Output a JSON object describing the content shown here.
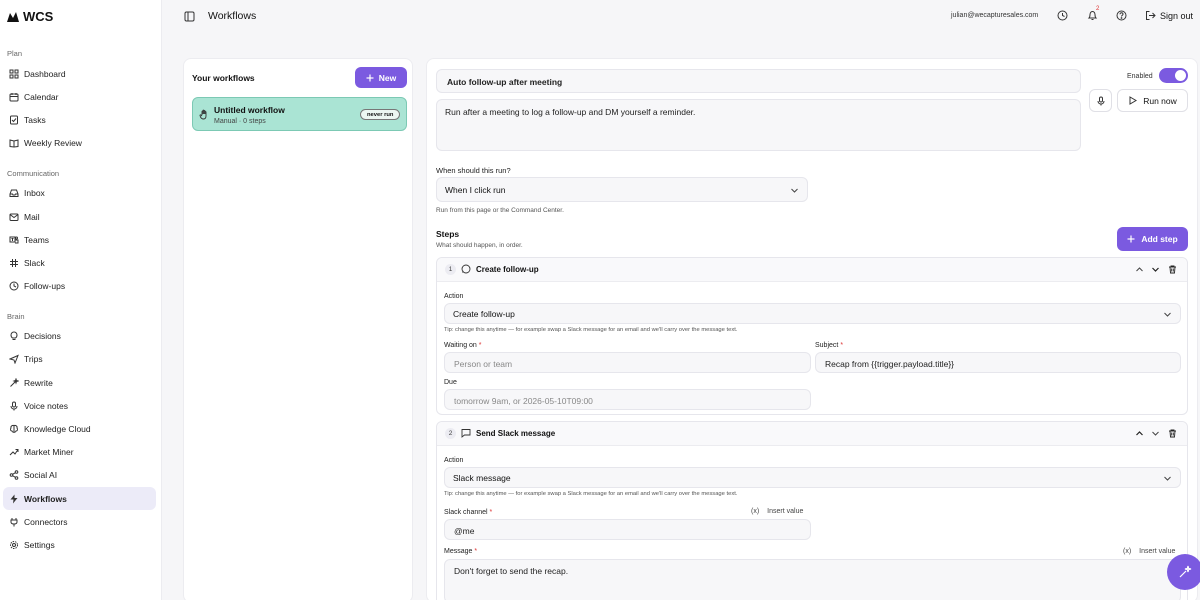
{
  "app": {
    "logo_text": "WCS"
  },
  "sidebar": {
    "sections": [
      {
        "label": "Plan",
        "items": [
          {
            "label": "Dashboard",
            "icon": "grid-icon"
          },
          {
            "label": "Calendar",
            "icon": "calendar-icon"
          },
          {
            "label": "Tasks",
            "icon": "checklist-icon"
          },
          {
            "label": "Weekly Review",
            "icon": "book-icon"
          }
        ]
      },
      {
        "label": "Communication",
        "items": [
          {
            "label": "Inbox",
            "icon": "inbox-icon"
          },
          {
            "label": "Mail",
            "icon": "mail-icon"
          },
          {
            "label": "Teams",
            "icon": "teams-icon"
          },
          {
            "label": "Slack",
            "icon": "slack-icon"
          },
          {
            "label": "Follow-ups",
            "icon": "clock-icon"
          }
        ]
      },
      {
        "label": "Brain",
        "items": [
          {
            "label": "Decisions",
            "icon": "bulb-icon"
          },
          {
            "label": "Trips",
            "icon": "plane-icon"
          },
          {
            "label": "Rewrite",
            "icon": "wand-icon"
          },
          {
            "label": "Voice notes",
            "icon": "mic-icon"
          },
          {
            "label": "Knowledge Cloud",
            "icon": "brain-icon"
          },
          {
            "label": "Market Miner",
            "icon": "trend-icon"
          },
          {
            "label": "Social AI",
            "icon": "share-icon"
          },
          {
            "label": "Workflows",
            "icon": "workflow-icon",
            "active": true
          },
          {
            "label": "Connectors",
            "icon": "plug-icon"
          },
          {
            "label": "Settings",
            "icon": "gear-icon"
          }
        ]
      }
    ]
  },
  "topbar": {
    "title": "Workflows",
    "email": "julian@wecapturesales.com",
    "notification_count": "2",
    "signout_label": "Sign out"
  },
  "workflows_panel": {
    "title": "Your workflows",
    "new_label": "New",
    "items": [
      {
        "name": "Untitled workflow",
        "meta": "Manual · 0 steps",
        "badge": "never run"
      }
    ]
  },
  "editor": {
    "name": "Auto follow-up after meeting",
    "description": "Run after a meeting to log a follow-up and DM yourself a reminder.",
    "enabled_label": "Enabled",
    "enabled": true,
    "run_now_label": "Run now",
    "trigger_label": "When should this run?",
    "trigger_value": "When I click run",
    "trigger_hint": "Run from this page or the Command Center.",
    "steps_title": "Steps",
    "steps_subtitle": "What should happen, in order.",
    "add_step_label": "Add step",
    "steps": [
      {
        "number": "1",
        "title": "Create follow-up",
        "action_label": "Action",
        "action_value": "Create follow-up",
        "tip": "Tip: change this anytime — for example swap a Slack message for an email and we'll carry over the message text.",
        "waiting_label": "Waiting on",
        "waiting_placeholder": "Person or team",
        "subject_label": "Subject",
        "subject_value": "Recap from {{trigger.payload.title}}",
        "due_label": "Due",
        "due_placeholder": "tomorrow 9am, or 2026-05-10T09:00"
      },
      {
        "number": "2",
        "title": "Send Slack message",
        "action_label": "Action",
        "action_value": "Slack message",
        "tip": "Tip: change this anytime — for example swap a Slack message for an email and we'll carry over the message text.",
        "channel_label": "Slack channel",
        "channel_value": "@me",
        "insert_label": "Insert value",
        "message_label": "Message",
        "message_value": "Don't forget to send the recap.",
        "insert_label_2": "Insert value"
      }
    ]
  },
  "colors": {
    "accent": "#7b5ae0",
    "selected_card": "#aae4d4"
  }
}
